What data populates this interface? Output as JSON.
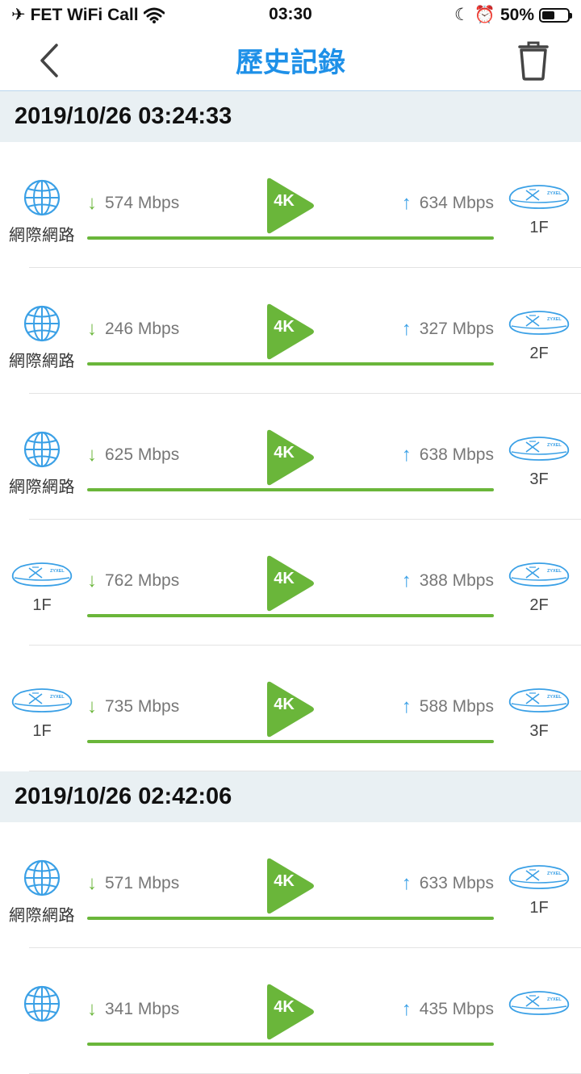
{
  "status_bar": {
    "carrier": "FET WiFi Call",
    "time": "03:30",
    "battery": "50%",
    "battery_level": 0.5
  },
  "navbar": {
    "title": "歷史記錄",
    "back_icon": "chevron-left-icon",
    "trash_icon": "trash-icon"
  },
  "colors": {
    "accent": "#1e90e8",
    "speed_line": "#6ab63a",
    "down_arrow": "#6ab63a",
    "up_arrow": "#3aa0e6",
    "section_bg": "#e9f0f3"
  },
  "sections": [
    {
      "timestamp": "2019/10/26 03:24:33",
      "rows": [
        {
          "from": "網際網路",
          "from_type": "globe",
          "down": "574 Mbps",
          "badge": "4K",
          "up": "634 Mbps",
          "to": "1F"
        },
        {
          "from": "網際網路",
          "from_type": "globe",
          "down": "246 Mbps",
          "badge": "4K",
          "up": "327 Mbps",
          "to": "2F"
        },
        {
          "from": "網際網路",
          "from_type": "globe",
          "down": "625 Mbps",
          "badge": "4K",
          "up": "638 Mbps",
          "to": "3F"
        },
        {
          "from": "1F",
          "from_type": "router",
          "down": "762 Mbps",
          "badge": "4K",
          "up": "388 Mbps",
          "to": "2F"
        },
        {
          "from": "1F",
          "from_type": "router",
          "down": "735 Mbps",
          "badge": "4K",
          "up": "588 Mbps",
          "to": "3F"
        }
      ]
    },
    {
      "timestamp": "2019/10/26 02:42:06",
      "rows": [
        {
          "from": "網際網路",
          "from_type": "globe",
          "down": "571 Mbps",
          "badge": "4K",
          "up": "633 Mbps",
          "to": "1F"
        },
        {
          "from": "",
          "from_type": "globe",
          "down": "341 Mbps",
          "badge": "4K",
          "up": "435 Mbps",
          "to": ""
        }
      ]
    }
  ],
  "router_brand": "ZYXEL"
}
